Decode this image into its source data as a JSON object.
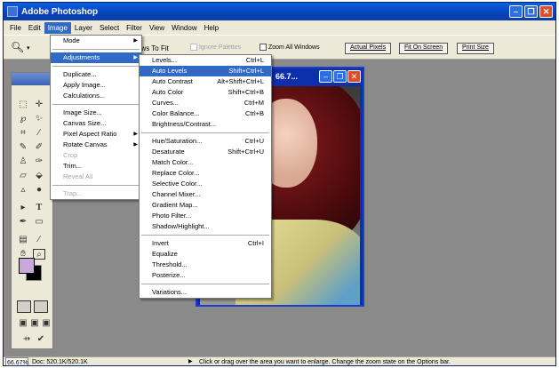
{
  "window": {
    "title": "Adobe Photoshop",
    "logo": "Ps"
  },
  "menubar": [
    "File",
    "Edit",
    "Image",
    "Layer",
    "Select",
    "Filter",
    "View",
    "Window",
    "Help"
  ],
  "options": {
    "partial_label": "ows To Fit",
    "ignore_palettes": "Ignore Palettes",
    "zoom_all": "Zoom All Windows",
    "actual_pixels": "Actual Pixels",
    "fit_on_screen": "Fit On Screen",
    "print_size": "Print Size"
  },
  "image_menu": [
    {
      "label": "Mode",
      "sub": true
    },
    {
      "sep": true
    },
    {
      "label": "Adjustments",
      "sub": true,
      "highlight": true
    },
    {
      "sep": true
    },
    {
      "label": "Duplicate..."
    },
    {
      "label": "Apply Image..."
    },
    {
      "label": "Calculations..."
    },
    {
      "sep": true
    },
    {
      "label": "Image Size..."
    },
    {
      "label": "Canvas Size..."
    },
    {
      "label": "Pixel Aspect Ratio",
      "sub": true
    },
    {
      "label": "Rotate Canvas",
      "sub": true
    },
    {
      "label": "Crop",
      "disabled": true
    },
    {
      "label": "Trim..."
    },
    {
      "label": "Reveal All",
      "disabled": true
    },
    {
      "sep": true
    },
    {
      "label": "Trap...",
      "disabled": true
    }
  ],
  "adjustments_menu": [
    {
      "label": "Levels...",
      "shortcut": "Ctrl+L"
    },
    {
      "label": "Auto Levels",
      "shortcut": "Shift+Ctrl+L",
      "highlight": true
    },
    {
      "label": "Auto Contrast",
      "shortcut": "Alt+Shift+Ctrl+L"
    },
    {
      "label": "Auto Color",
      "shortcut": "Shift+Ctrl+B"
    },
    {
      "label": "Curves...",
      "shortcut": "Ctrl+M"
    },
    {
      "label": "Color Balance...",
      "shortcut": "Ctrl+B"
    },
    {
      "label": "Brightness/Contrast..."
    },
    {
      "sep": true
    },
    {
      "label": "Hue/Saturation...",
      "shortcut": "Ctrl+U"
    },
    {
      "label": "Desaturate",
      "shortcut": "Shift+Ctrl+U"
    },
    {
      "label": "Match Color..."
    },
    {
      "label": "Replace Color..."
    },
    {
      "label": "Selective Color..."
    },
    {
      "label": "Channel Mixer..."
    },
    {
      "label": "Gradient Map..."
    },
    {
      "label": "Photo Filter..."
    },
    {
      "label": "Shadow/Highlight..."
    },
    {
      "sep": true
    },
    {
      "label": "Invert",
      "shortcut": "Ctrl+I"
    },
    {
      "label": "Equalize"
    },
    {
      "label": "Threshold..."
    },
    {
      "label": "Posterize..."
    },
    {
      "sep": true
    },
    {
      "label": "Variations..."
    }
  ],
  "document": {
    "title": "66.7..."
  },
  "status": {
    "zoom": "66.67%",
    "doc": "Doc: 520.1K/520.1K",
    "hint": "Click or drag over the area you want to enlarge. Change the zoom state on the Options bar."
  }
}
